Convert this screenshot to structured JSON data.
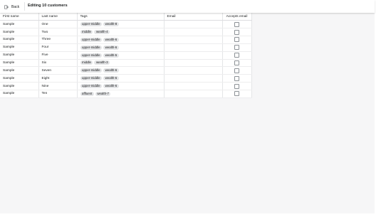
{
  "header": {
    "back_label": "Back",
    "title": "Editing 10 customers"
  },
  "table": {
    "columns": [
      "First name",
      "Last name",
      "Tags",
      "Email",
      "Accepts email"
    ],
    "rows": [
      {
        "first": "Sample",
        "last": "One",
        "tags": [
          "upper-middle",
          "wealth-8"
        ],
        "email": "",
        "accepts": false
      },
      {
        "first": "Sample",
        "last": "Two",
        "tags": [
          "middle",
          "wealth-4"
        ],
        "email": "",
        "accepts": false
      },
      {
        "first": "Sample",
        "last": "Three",
        "tags": [
          "upper-middle",
          "wealth-6"
        ],
        "email": "",
        "accepts": false
      },
      {
        "first": "Sample",
        "last": "Four",
        "tags": [
          "upper-middle",
          "wealth-6"
        ],
        "email": "",
        "accepts": false
      },
      {
        "first": "Sample",
        "last": "Five",
        "tags": [
          "upper-middle",
          "wealth-5"
        ],
        "email": "",
        "accepts": false
      },
      {
        "first": "Sample",
        "last": "Six",
        "tags": [
          "middle",
          "wealth-3"
        ],
        "email": "",
        "accepts": false
      },
      {
        "first": "Sample",
        "last": "Seven",
        "tags": [
          "upper-middle",
          "wealth-6"
        ],
        "email": "",
        "accepts": false
      },
      {
        "first": "Sample",
        "last": "Eight",
        "tags": [
          "upper-middle",
          "wealth-6"
        ],
        "email": "",
        "accepts": false
      },
      {
        "first": "Sample",
        "last": "Nine",
        "tags": [
          "upper-middle",
          "wealth-6"
        ],
        "email": "",
        "accepts": false
      },
      {
        "first": "Sample",
        "last": "Ten",
        "tags": [
          "affluent",
          "wealth-7"
        ],
        "email": "",
        "accepts": false
      }
    ]
  },
  "colors": {
    "canvas": "#f6f6f7",
    "tag_bg": "#e4e5e7",
    "border": "#e4e5e7"
  },
  "icons": {
    "back": "back-exit-icon"
  }
}
